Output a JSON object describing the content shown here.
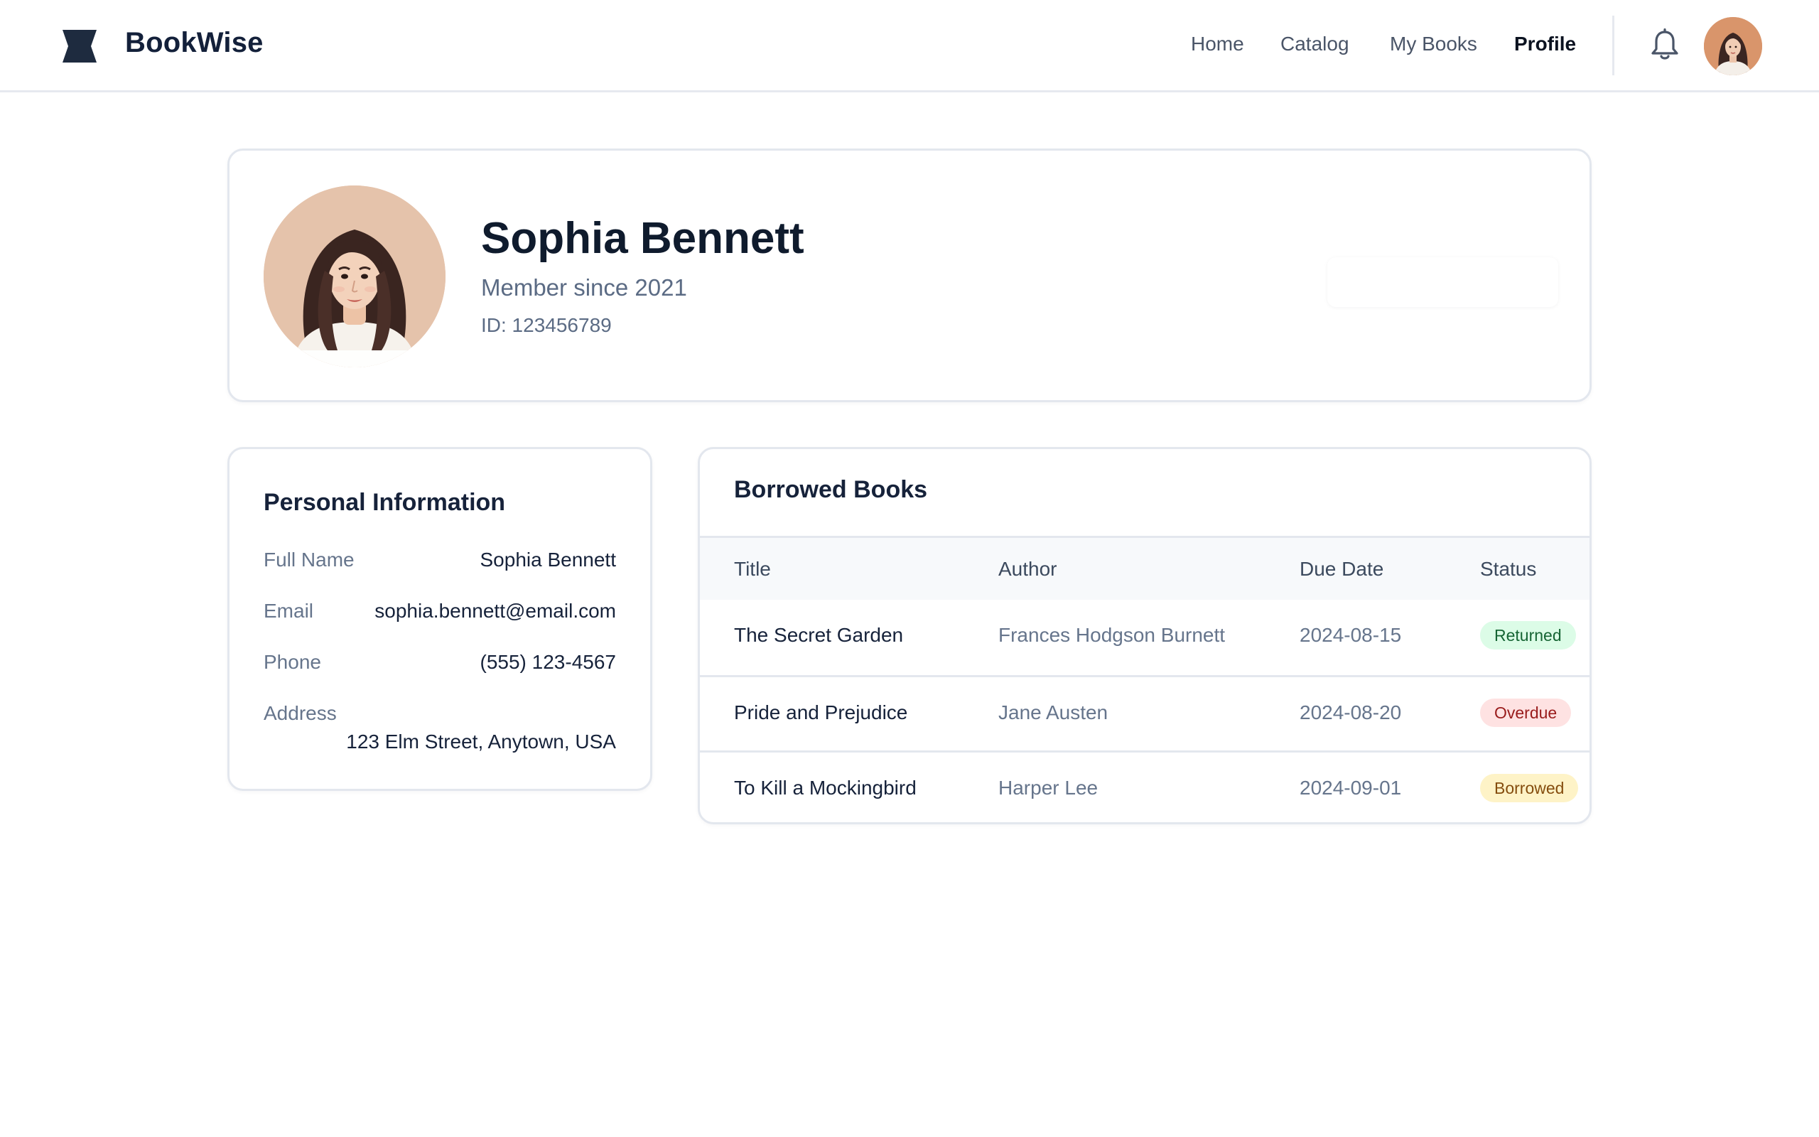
{
  "header": {
    "brand": "BookWise",
    "nav": [
      {
        "label": "Home",
        "active": false
      },
      {
        "label": "Catalog",
        "active": false
      },
      {
        "label": "My Books",
        "active": false
      },
      {
        "label": "Profile",
        "active": true
      }
    ],
    "icons": {
      "logo": "book-logo-icon",
      "notifications": "bell-icon",
      "avatar": "user-avatar"
    }
  },
  "profile": {
    "name": "Sophia Bennett",
    "member_since": "Member since 2021",
    "member_id": "ID: 123456789"
  },
  "personal_info": {
    "title": "Personal Information",
    "fields": [
      {
        "label": "Full Name",
        "value": "Sophia Bennett"
      },
      {
        "label": "Email",
        "value": "sophia.bennett@email.com"
      },
      {
        "label": "Phone",
        "value": "(555) 123-4567"
      },
      {
        "label": "Address",
        "value": "123 Elm Street, Anytown, USA"
      }
    ]
  },
  "borrowed_books": {
    "title": "Borrowed Books",
    "columns": [
      "Title",
      "Author",
      "Due Date",
      "Status"
    ],
    "rows": [
      {
        "title": "The Secret Garden",
        "author": "Frances Hodgson Burnett",
        "due_date": "2024-08-15",
        "status": "Returned"
      },
      {
        "title": "Pride and Prejudice",
        "author": "Jane Austen",
        "due_date": "2024-08-20",
        "status": "Overdue"
      },
      {
        "title": "To Kill a Mockingbird",
        "author": "Harper Lee",
        "due_date": "2024-09-01",
        "status": "Borrowed"
      }
    ]
  },
  "colors": {
    "primary_text": "#0f1b2d",
    "muted_text": "#66758c",
    "border": "#e3e7ee",
    "returned_bg": "#dcfce7",
    "returned_text": "#166534",
    "overdue_bg": "#fee2e2",
    "overdue_text": "#991b1b",
    "borrowed_bg": "#fef3c7",
    "borrowed_text": "#854d0e"
  }
}
